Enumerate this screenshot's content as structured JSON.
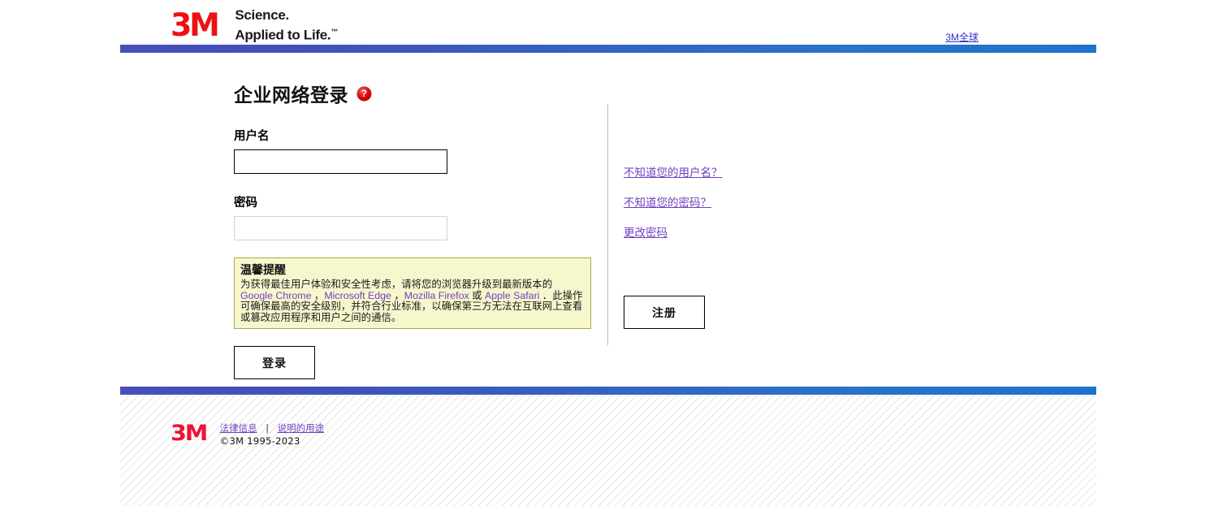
{
  "header": {
    "logo_text": "3M",
    "tagline_line1": "Science.",
    "tagline_line2": "Applied to Life.",
    "tagline_tm": "™",
    "global_link": "3M全球"
  },
  "colors": {
    "gradient_start": "#4650B8",
    "gradient_end": "#1E73CC",
    "link_purple": "#6F3FBF",
    "link_blue": "#3333CC",
    "brand_red": "#EE1111",
    "warning_bg": "#F7F7CE",
    "warning_border": "#A8A84A"
  },
  "main": {
    "title": "企业网络登录",
    "help_icon_glyph": "?",
    "username": {
      "label": "用户名",
      "value": "",
      "placeholder": ""
    },
    "password": {
      "label": "密码",
      "value": "",
      "placeholder": ""
    },
    "warning": {
      "title": "温馨提醒",
      "text_part1": "为获得最佳用户体验和安全性考虑，请将您的浏览器升级到最新版本的 ",
      "browser1": "Google Chrome",
      "sep1": " ，",
      "browser2": "Microsoft Edge",
      "sep2": " ，",
      "browser3": "Mozilla Firefox",
      "sep3": " 或 ",
      "browser4": "Apple Safari",
      "text_part2": " ．此操作可确保最高的安全级别，并符合行业标准，以确保第三方无法在互联网上查看或篡改应用程序和用户之间的通信。"
    },
    "login_button": "登录"
  },
  "sidebar": {
    "links": [
      {
        "label": "不知道您的用户名？"
      },
      {
        "label": "不知道您的密码？"
      },
      {
        "label": "更改密码"
      }
    ],
    "register_button": "注册"
  },
  "footer": {
    "logo_text": "3M",
    "link_legal": "法律信息",
    "separator": "|",
    "link_usage": "说明的用途",
    "copyright": "©3M 1995-2023"
  }
}
